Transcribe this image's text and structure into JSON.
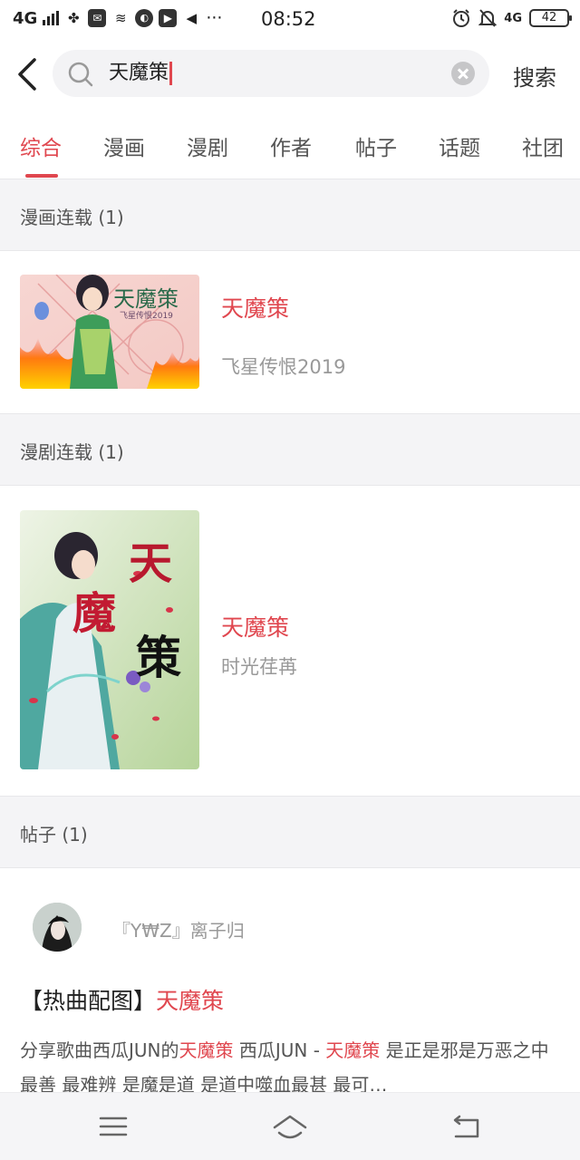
{
  "status_bar": {
    "network": "4G",
    "time": "08:52",
    "right_network": "4G",
    "battery": "42",
    "more": "···"
  },
  "search": {
    "query": "天魔策",
    "submit_label": "搜索"
  },
  "tabs": [
    {
      "label": "综合",
      "active": true
    },
    {
      "label": "漫画",
      "active": false
    },
    {
      "label": "漫剧",
      "active": false
    },
    {
      "label": "作者",
      "active": false
    },
    {
      "label": "帖子",
      "active": false
    },
    {
      "label": "话题",
      "active": false
    },
    {
      "label": "社团",
      "active": false
    }
  ],
  "sections": {
    "comics": {
      "header": "漫画连载 (1)",
      "items": [
        {
          "title": "天魔策",
          "author": "飞星传恨2019",
          "cover_text": "天魔策",
          "cover_caption": "飞星传恨2019"
        }
      ]
    },
    "dramas": {
      "header": "漫剧连载 (1)",
      "items": [
        {
          "title": "天魔策",
          "author": "时光荏苒",
          "cover_text": [
            "天",
            "魔",
            "策"
          ]
        }
      ]
    },
    "posts": {
      "header": "帖子 (1)",
      "items": [
        {
          "user": "『Y₩Z』离子归",
          "title_prefix": "【热曲配图】",
          "title_highlight": "天魔策",
          "body": [
            {
              "text": "分享歌曲西瓜JUN的",
              "hl": false
            },
            {
              "text": "天魔策",
              "hl": true
            },
            {
              "text": " 西瓜JUN - ",
              "hl": false
            },
            {
              "text": "天魔策",
              "hl": true
            },
            {
              "text": " 是正是邪是万恶之中最善 最难辨 是魔是道 是道中噬血最甚 最可…",
              "hl": false
            }
          ]
        }
      ]
    }
  },
  "colors": {
    "accent": "#e0474f",
    "section_bg": "#f4f4f6",
    "muted_text": "#999999"
  }
}
